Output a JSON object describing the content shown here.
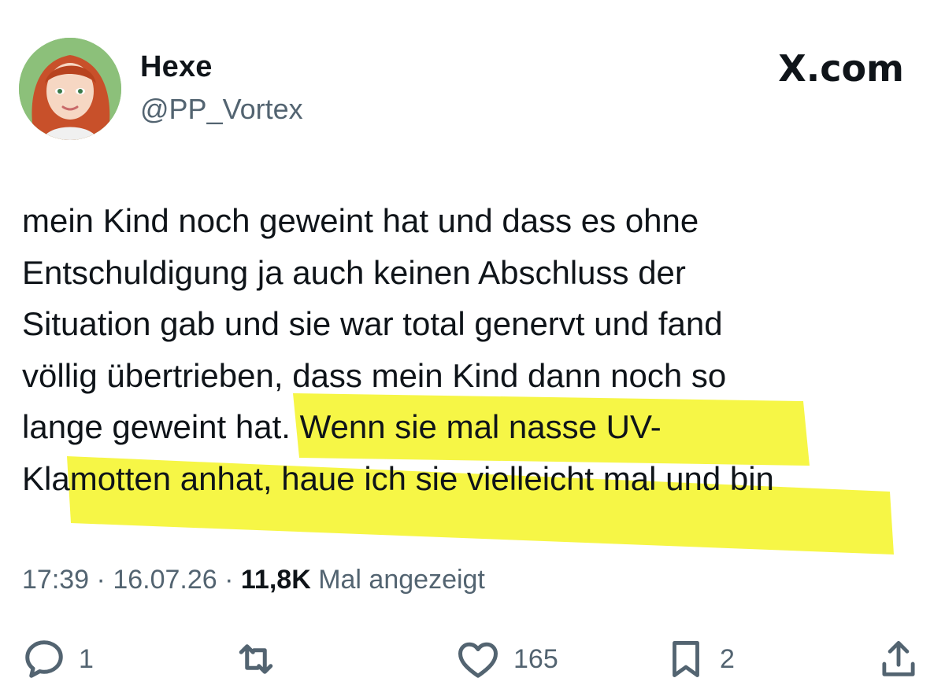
{
  "author": {
    "display_name": "Hexe",
    "handle": "@PP_Vortex",
    "avatar_icon": "avatar-illustration-red-hair"
  },
  "brand": {
    "label": "X.com"
  },
  "tweet": {
    "lines": [
      "mein Kind noch geweint hat und dass es ohne",
      "Entschuldigung ja auch keinen Abschluss der",
      "Situation gab und sie war total genervt und fand",
      "völlig übertrieben, dass mein Kind dann noch so",
      "lange geweint hat. Wenn sie mal nasse UV-",
      "Klamotten anhat, haue ich sie vielleicht mal und bin"
    ],
    "highlight_color": "#f5f526"
  },
  "meta": {
    "time": "17:39",
    "date": "16.07.26",
    "separator": " · ",
    "views_count": "11,8K",
    "views_label": " Mal angezeigt"
  },
  "actions": {
    "reply": {
      "icon": "reply-icon",
      "count": "1"
    },
    "repost": {
      "icon": "repost-icon",
      "count": ""
    },
    "like": {
      "icon": "heart-icon",
      "count": "165"
    },
    "bookmark": {
      "icon": "bookmark-icon",
      "count": "2"
    },
    "share": {
      "icon": "share-icon",
      "count": ""
    }
  },
  "colors": {
    "text": "#0f1419",
    "secondary": "#536471",
    "highlight": "#f5f526"
  }
}
